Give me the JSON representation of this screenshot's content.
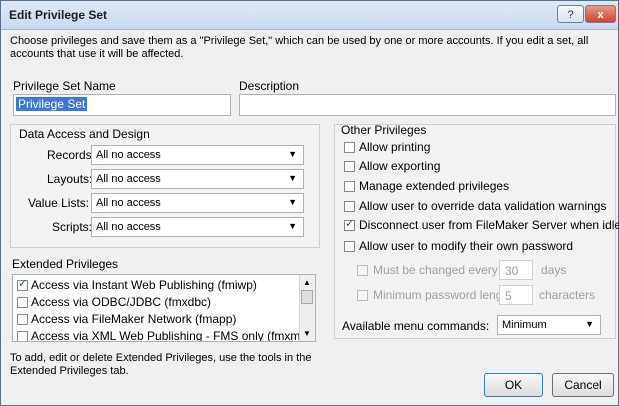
{
  "window": {
    "title": "Edit Privilege Set",
    "help": "?",
    "close": "x"
  },
  "intro": "Choose privileges and save them as a \"Privilege Set,\" which can be used by one or more accounts. If you edit a set, all accounts that use it will be affected.",
  "name": {
    "label": "Privilege Set Name",
    "value": "Privilege Set"
  },
  "description": {
    "label": "Description",
    "value": ""
  },
  "data_access": {
    "title": "Data Access and Design",
    "rows": [
      {
        "label": "Records:",
        "value": "All no access"
      },
      {
        "label": "Layouts:",
        "value": "All no access"
      },
      {
        "label": "Value Lists:",
        "value": "All no access"
      },
      {
        "label": "Scripts:",
        "value": "All no access"
      }
    ]
  },
  "other": {
    "title": "Other Privileges",
    "items": [
      {
        "label": "Allow printing",
        "checked": false
      },
      {
        "label": "Allow exporting",
        "checked": false
      },
      {
        "label": "Manage extended privileges",
        "checked": false
      },
      {
        "label": "Allow user to override data validation warnings",
        "checked": false
      },
      {
        "label": "Disconnect user from FileMaker Server when idle",
        "checked": true
      },
      {
        "label": "Allow user to modify their own password",
        "checked": false
      }
    ],
    "must_change": {
      "label": "Must be changed every",
      "value": "30",
      "unit": "days"
    },
    "min_length": {
      "label": "Minimum password length:",
      "value": "5",
      "unit": "characters"
    },
    "menu": {
      "label": "Available menu commands:",
      "value": "Minimum"
    }
  },
  "extended": {
    "title": "Extended Privileges",
    "items": [
      {
        "label": "Access via Instant Web Publishing (fmiwp)",
        "checked": true
      },
      {
        "label": "Access via ODBC/JDBC (fmxdbc)",
        "checked": false
      },
      {
        "label": "Access via FileMaker Network (fmapp)",
        "checked": false
      },
      {
        "label": "Access via XML Web Publishing - FMS only (fmxml)",
        "checked": false
      }
    ],
    "note": "To add, edit or delete Extended Privileges, use the tools in the Extended Privileges tab."
  },
  "buttons": {
    "ok": "OK",
    "cancel": "Cancel"
  }
}
